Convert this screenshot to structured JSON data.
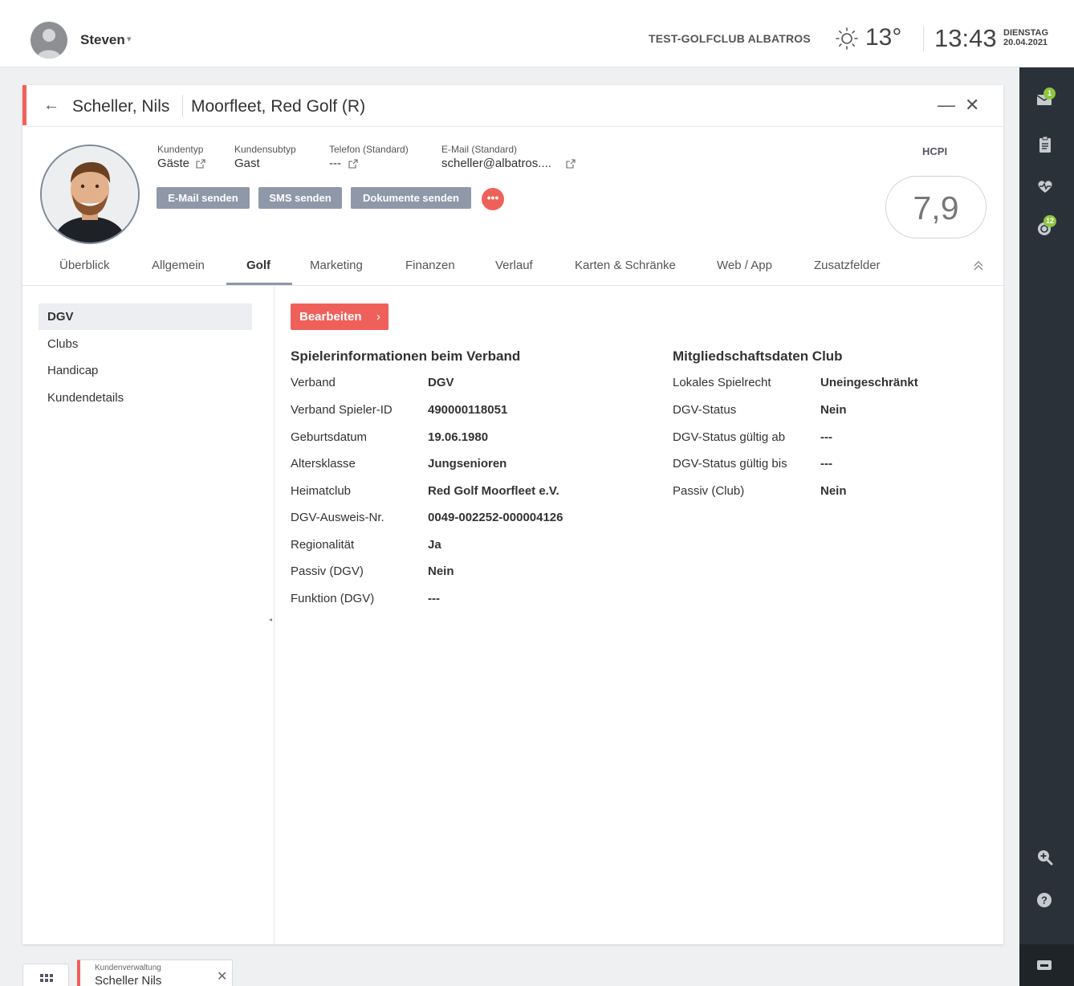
{
  "topbar": {
    "user_name": "Steven",
    "user_caret": "▾",
    "club_name": "TEST-GOLFCLUB ALBATROS",
    "temperature": "13°",
    "time": "13:43",
    "weekday": "DIENSTAG",
    "date": "20.04.2021"
  },
  "rail": {
    "mail_badge": "1",
    "golf_badge": "12"
  },
  "header": {
    "back_arrow": "←",
    "name": "Scheller, Nils",
    "club": "Moorfleet, Red Golf (R)",
    "minimize": "—",
    "close": "✕"
  },
  "profile": {
    "kundentyp_label": "Kundentyp",
    "kundentyp_value": "Gäste",
    "kundensubtyp_label": "Kundensubtyp",
    "kundensubtyp_value": "Gast",
    "telefon_label": "Telefon (Standard)",
    "telefon_value": "---",
    "email_label": "E-Mail (Standard)",
    "email_value": "scheller@albatros....",
    "hcpi_label": "HCPI",
    "hcpi_value": "7,9"
  },
  "actions": {
    "email": "E-Mail senden",
    "sms": "SMS senden",
    "documents": "Dokumente senden",
    "more": "•••"
  },
  "tabs": [
    {
      "label": "Überblick"
    },
    {
      "label": "Allgemein"
    },
    {
      "label": "Golf"
    },
    {
      "label": "Marketing"
    },
    {
      "label": "Finanzen"
    },
    {
      "label": "Verlauf"
    },
    {
      "label": "Karten & Schränke"
    },
    {
      "label": "Web / App"
    },
    {
      "label": "Zusatzfelder"
    }
  ],
  "collapse_icon": "⌃",
  "leftnav": [
    {
      "label": "DGV"
    },
    {
      "label": "Clubs"
    },
    {
      "label": "Handicap"
    },
    {
      "label": "Kundendetails"
    }
  ],
  "edit": {
    "label": "Bearbeiten",
    "chevron": "›"
  },
  "spieler": {
    "title": "Spielerinformationen beim Verband",
    "rows": [
      {
        "label": "Verband",
        "value": "DGV"
      },
      {
        "label": "Verband Spieler-ID",
        "value": "490000118051"
      },
      {
        "label": "Geburtsdatum",
        "value": "19.06.1980"
      },
      {
        "label": "Altersklasse",
        "value": "Jungsenioren"
      },
      {
        "label": "Heimatclub",
        "value": "Red Golf Moorfleet e.V."
      },
      {
        "label": "DGV-Ausweis-Nr.",
        "value": "0049-002252-000004126"
      },
      {
        "label": "Regionalität",
        "value": "Ja"
      },
      {
        "label": "Passiv (DGV)",
        "value": "Nein"
      },
      {
        "label": "Funktion (DGV)",
        "value": "---"
      }
    ]
  },
  "mitglied": {
    "title": "Mitgliedschaftsdaten Club",
    "rows": [
      {
        "label": "Lokales Spielrecht",
        "value": "Uneingeschränkt"
      },
      {
        "label": "DGV-Status",
        "value": "Nein"
      },
      {
        "label": "DGV-Status gültig ab",
        "value": "---"
      },
      {
        "label": "DGV-Status gültig bis",
        "value": "---"
      },
      {
        "label": "Passiv (Club)",
        "value": "Nein"
      }
    ]
  },
  "taskbar": {
    "subtitle": "Kundenverwaltung",
    "title": "Scheller Nils",
    "close": "✕"
  },
  "colors": {
    "accent": "#f0605b",
    "button_gray": "#8e98a8",
    "rail": "#2b3138",
    "badge": "#8cc63e"
  }
}
